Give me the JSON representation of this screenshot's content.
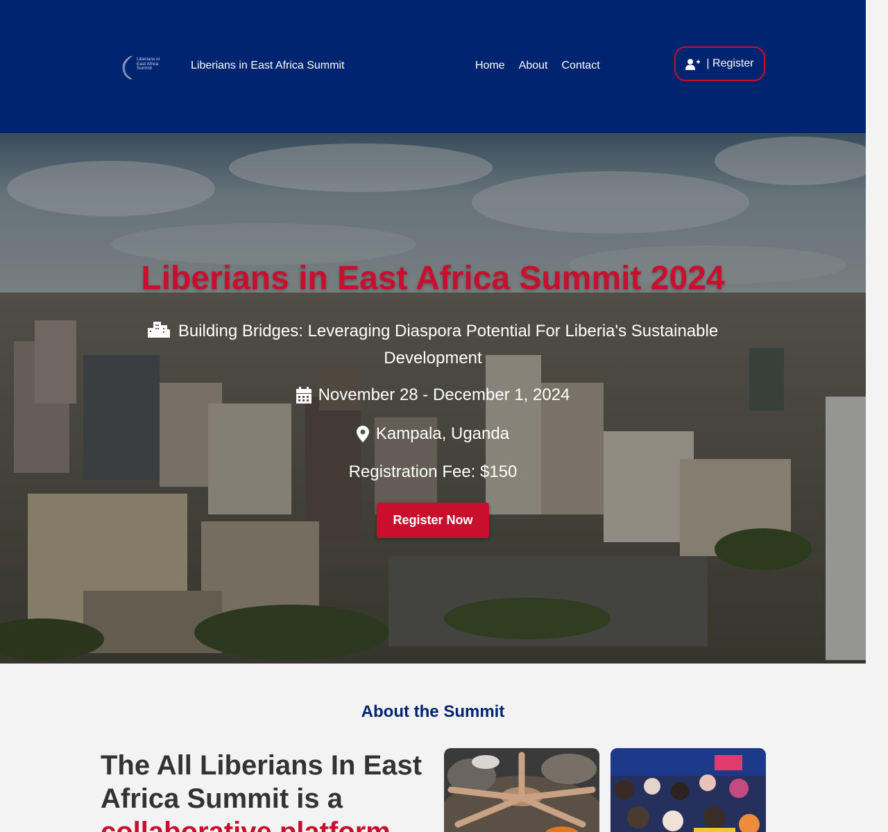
{
  "header": {
    "logo_text": "Liberians in East Africa Summit",
    "site_title": "Liberians in East Africa Summit",
    "nav": [
      {
        "label": "Home"
      },
      {
        "label": "About"
      },
      {
        "label": "Contact"
      }
    ],
    "register_label": "| Register",
    "register_icon": "user-plus-icon"
  },
  "hero": {
    "title": "Liberians in East Africa Summit 2024",
    "theme": "Building Bridges: Leveraging Diaspora Potential For Liberia's Sustainable Development",
    "theme_icon": "city-icon",
    "date": "November 28 - December 1, 2024",
    "date_icon": "calendar-icon",
    "location": "Kampala, Uganda",
    "location_icon": "map-pin-icon",
    "fee": "Registration Fee: $150",
    "cta_label": "Register Now"
  },
  "about": {
    "heading": "About the Summit",
    "intro": "The All Liberians In East Africa Summit is a",
    "intro_accent": "collaborative platform"
  },
  "colors": {
    "navy": "#002470",
    "red": "#c8102e",
    "background": "#f3f3f3",
    "text_dark": "#333333"
  }
}
